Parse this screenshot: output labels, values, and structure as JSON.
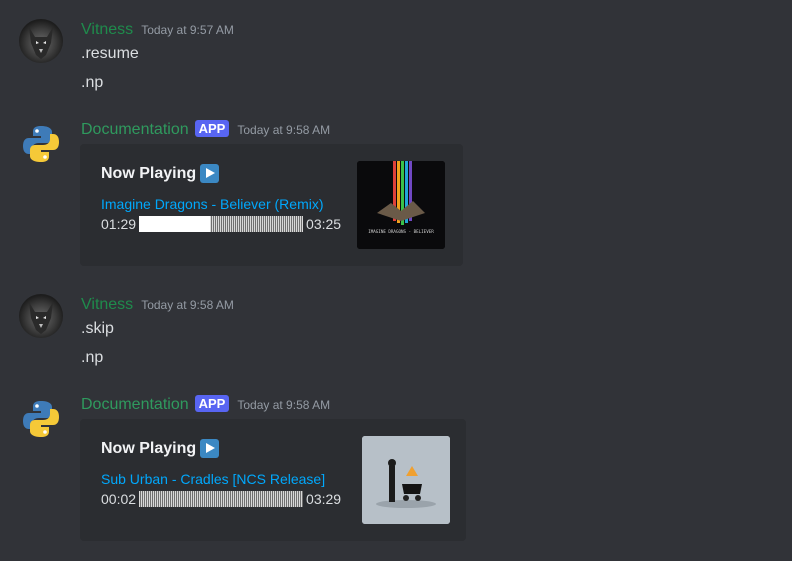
{
  "messages": [
    {
      "author": "Vitness",
      "timestamp": "Today at 9:57 AM",
      "lines": [
        ".resume",
        ".np"
      ]
    },
    {
      "author": "Documentation",
      "badge": "APP",
      "timestamp": "Today at 9:58 AM",
      "embed": {
        "title": "Now Playing",
        "title_emoji": "play-button-icon",
        "track": "Imagine Dragons - Believer (Remix)",
        "elapsed": "01:29",
        "duration": "03:25",
        "progress_fraction": 0.43,
        "thumbnail_text": "IMAGINE DRAGONS - BELIEVER"
      }
    },
    {
      "author": "Vitness",
      "timestamp": "Today at 9:58 AM",
      "lines": [
        ".skip",
        ".np"
      ]
    },
    {
      "author": "Documentation",
      "badge": "APP",
      "timestamp": "Today at 9:58 AM",
      "embed": {
        "title": "Now Playing",
        "title_emoji": "play-button-icon",
        "track": "Sub Urban - Cradles [NCS Release]",
        "elapsed": "00:02",
        "duration": "03:29",
        "progress_fraction": 0.0
      }
    }
  ],
  "colors": {
    "background": "#313338",
    "embed_bg": "#2b2d31",
    "link": "#00a8fc",
    "username_green": "#1f8b4c",
    "app_badge": "#5865f2"
  }
}
